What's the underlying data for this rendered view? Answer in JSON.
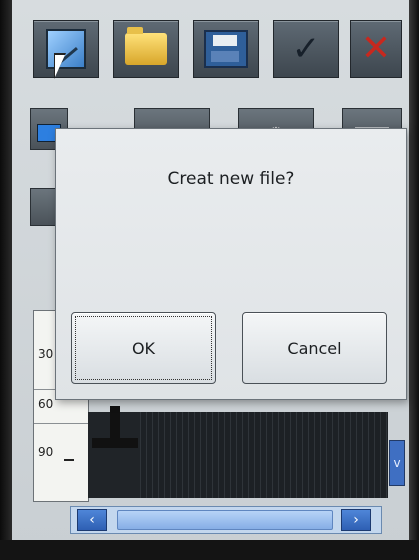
{
  "dialog": {
    "message": "Creat new file?",
    "ok_label": "OK",
    "cancel_label": "Cancel"
  },
  "toolbar": {
    "buttons": [
      "edit-icon",
      "folder-icon",
      "save-icon",
      "check-icon",
      "close-icon"
    ]
  },
  "ruler": {
    "ticks": [
      "30",
      "60",
      "90"
    ]
  },
  "scrollbar": {
    "left_arrow": "‹",
    "right_arrow": "›",
    "up_arrow": "^",
    "down_arrow": "v"
  }
}
